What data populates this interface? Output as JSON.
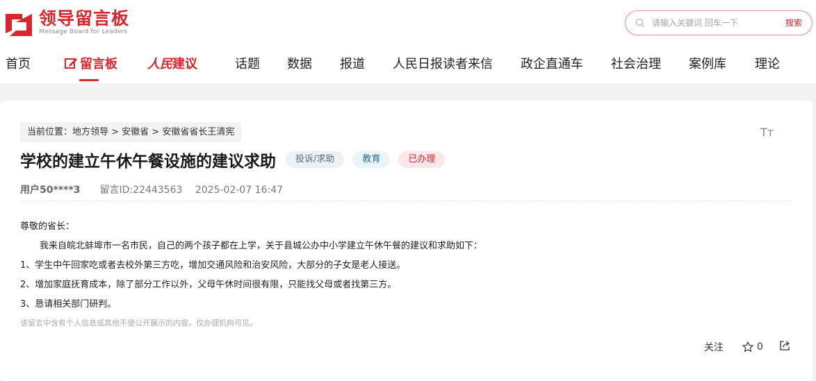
{
  "header": {
    "logo_cn": "领导留言板",
    "logo_en": "Message Board for Leaders",
    "search_placeholder": "请输入关键词 回车一下",
    "search_button": "搜索"
  },
  "nav": {
    "items": [
      "首页",
      "留言板",
      "建议",
      "话题",
      "数据",
      "报道",
      "人民日报读者来信",
      "政企直通车",
      "社会治理",
      "案例库",
      "理论"
    ],
    "brand_prefix": "人民",
    "active_index": 1
  },
  "page": {
    "breadcrumb": "当前位置：地方领导 > 安徽省 > 安徽省省长王清宪",
    "font_size_label": "Tт",
    "title": "学校的建立午休午餐设施的建议求助",
    "tags": {
      "type": "投诉/求助",
      "category": "教育",
      "status": "已办理"
    },
    "meta": {
      "user": "用户50****3",
      "message_id": "留言ID:22443563",
      "datetime": "2025-02-07 16:47"
    },
    "content": {
      "greeting": "尊敬的省长：",
      "intro": "我来自皖北蚌埠市一名市民，自己的两个孩子都在上学，关于县城公办中小学建立午休午餐的建议和求助如下：",
      "points": [
        "1、学生中午回家吃或者去校外第三方吃，增加交通风险和治安风险，大部分的子女是老人接送。",
        "2、增加家庭抚育成本，除了部分工作以外，父母午休时间很有限，只能找父母或者找第三方。",
        "3、恳请相关部门研判。"
      ],
      "privacy_note": "该留言中含有个人信息或其他不便公开展示的内容，仅办理机构可见。"
    },
    "actions": {
      "follow": "关注",
      "star_count": "0"
    }
  },
  "colors": {
    "brand_red": "#d7262d",
    "background_band": "#f3f3f4"
  }
}
